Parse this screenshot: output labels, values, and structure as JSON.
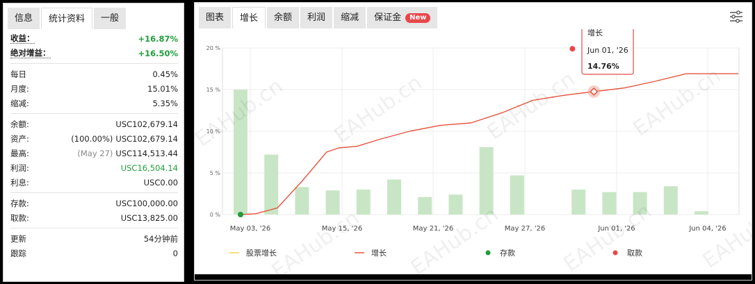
{
  "left_tabs": [
    "信息",
    "统计资料",
    "一般"
  ],
  "left_active_tab": 1,
  "stats": {
    "group1": [
      {
        "label": "收益：",
        "value": "+16.87%",
        "style": "green",
        "dotted": true
      },
      {
        "label": "绝对增益：",
        "value": "+16.50%",
        "style": "green",
        "dotted": true
      }
    ],
    "group2": [
      {
        "label": "每日",
        "value": "0.45%"
      },
      {
        "label": "月度:",
        "value": "15.01%"
      },
      {
        "label": "缩减:",
        "value": "5.35%"
      }
    ],
    "group3": [
      {
        "label": "余额:",
        "value": "USC102,679.14"
      },
      {
        "label": "资产:",
        "prefix": "(100.00%)",
        "value": "USC102,679.14"
      },
      {
        "label": "最高:",
        "prefix": "(May 27)",
        "prefix_muted": true,
        "value": "USC114,513.44"
      },
      {
        "label": "利润:",
        "value": "USC16,504.14",
        "style": "green-plain"
      },
      {
        "label": "利息:",
        "value": "USC0.00"
      }
    ],
    "group4": [
      {
        "label": "存款:",
        "value": "USC100,000.00"
      },
      {
        "label": "取款:",
        "value": "USC13,825.00"
      }
    ],
    "group5": [
      {
        "label": "更新",
        "value": "54分钟前"
      },
      {
        "label": "跟踪",
        "value": "0"
      }
    ]
  },
  "right_tabs": [
    {
      "label": "图表"
    },
    {
      "label": "增长"
    },
    {
      "label": "余额"
    },
    {
      "label": "利润"
    },
    {
      "label": "缩减"
    },
    {
      "label": "保证金",
      "badge": "New"
    }
  ],
  "right_active_tab": 1,
  "watermark_text": "EAHub.cn",
  "colors": {
    "growth_line": "#e4543d",
    "bar": "#c8e6c5",
    "deposit": "#1f9d3b",
    "withdraw": "#e8474a",
    "stock_growth": "#f2d24b",
    "tooltip_border": "#e8474a"
  },
  "chart_data": {
    "type": "bar",
    "x_labels": [
      "May 03, '26",
      "May 15, '26",
      "May 21, '26",
      "May 27, '26",
      "Jun 01, '26",
      "Jun 04, '26"
    ],
    "y_ticks": [
      "0 %",
      "5 %",
      "10 %",
      "15 %",
      "20 %"
    ],
    "ylim": [
      0,
      20
    ],
    "bars": [
      15.0,
      7.2,
      3.3,
      2.9,
      3.0,
      4.2,
      2.1,
      2.4,
      8.1,
      4.7,
      0,
      3.0,
      2.7,
      2.7,
      3.4,
      0.4
    ],
    "growth_line": [
      [
        0,
        0.0
      ],
      [
        0.5,
        0.1
      ],
      [
        1.2,
        0.8
      ],
      [
        2.0,
        4.0
      ],
      [
        2.8,
        7.5
      ],
      [
        3.2,
        8.0
      ],
      [
        3.8,
        8.2
      ],
      [
        4.5,
        9.0
      ],
      [
        5.5,
        10.0
      ],
      [
        6.5,
        10.7
      ],
      [
        7.5,
        11.0
      ],
      [
        8.5,
        12.2
      ],
      [
        9.5,
        13.7
      ],
      [
        10.5,
        14.3
      ],
      [
        11.5,
        14.76
      ],
      [
        12.5,
        15.2
      ],
      [
        13.5,
        16.0
      ],
      [
        14.5,
        16.9
      ],
      [
        15.0,
        16.9
      ],
      [
        16.2,
        16.9
      ]
    ],
    "deposits": [
      [
        0,
        0.0
      ]
    ],
    "withdrawals": [
      [
        10.8,
        19.9
      ]
    ],
    "legend": [
      {
        "label": "股票增长",
        "type": "line",
        "color_key": "stock_growth"
      },
      {
        "label": "增长",
        "type": "line",
        "color_key": "growth_line"
      },
      {
        "label": "存款",
        "type": "dot",
        "color_key": "deposit"
      },
      {
        "label": "取款",
        "type": "dot",
        "color_key": "withdraw"
      }
    ],
    "tooltip": {
      "title": "增长",
      "date": "Jun 01, '26",
      "value": "14.76%",
      "point": [
        11.5,
        14.76
      ]
    }
  }
}
